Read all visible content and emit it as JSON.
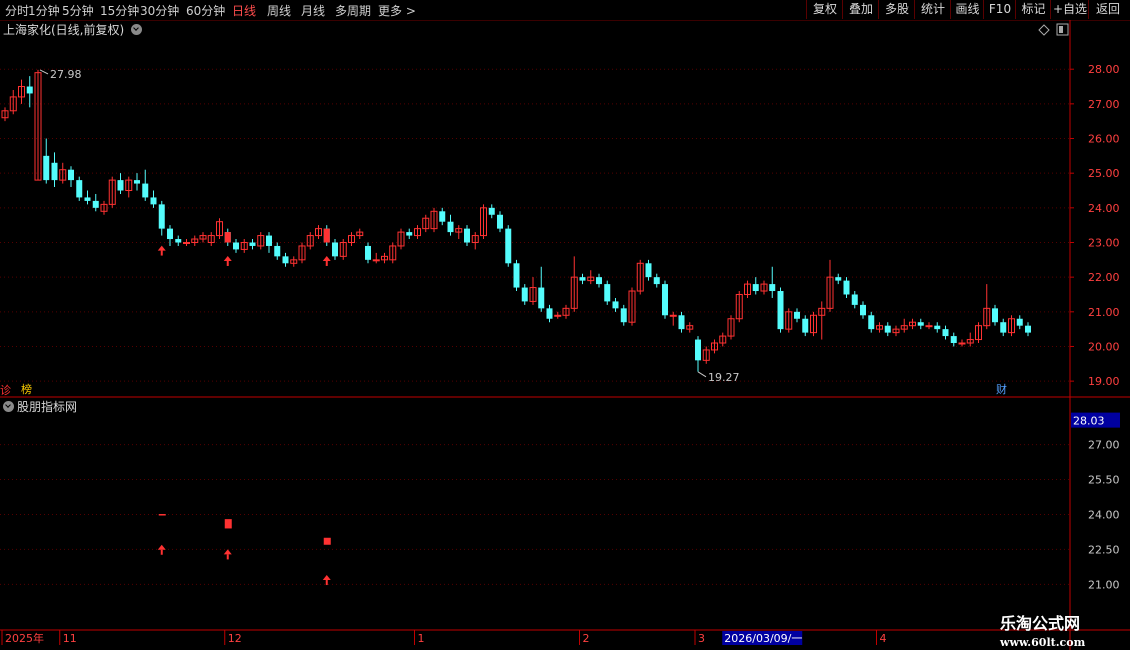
{
  "toolbar": {
    "periods": [
      "分时",
      "1分钟",
      "5分钟",
      "15分钟",
      "30分钟",
      "60分钟",
      "日线",
      "周线",
      "月线",
      "多周期",
      "更多 >"
    ],
    "active_period": "日线",
    "tools": [
      "复权",
      "叠加",
      "多股",
      "统计",
      "画线",
      "F10",
      "标记",
      "+自选",
      "返回"
    ]
  },
  "stock": {
    "title": "上海家化(日线,前复权)"
  },
  "markers": {
    "left_cut": "诊",
    "bang": "榜",
    "cai": "财"
  },
  "indicator": {
    "title": "股朋指标网",
    "current_value": "28.03"
  },
  "watermark": {
    "line1": "乐淘公式网",
    "line2": "www.60lt.com"
  },
  "colors": {
    "up": "#ff3232",
    "down": "#54fcfc",
    "grid": "#550000",
    "axis": "#c00000",
    "highlight": "#0000a0"
  },
  "chart_data": [
    {
      "type": "candlestick",
      "title": "上海家化(日线,前复权)",
      "ylim": [
        18.6,
        28.9
      ],
      "yticks": [
        19.0,
        20.0,
        21.0,
        22.0,
        23.0,
        24.0,
        25.0,
        26.0,
        27.0,
        28.0
      ],
      "ytick_labels": [
        "19.00",
        "20.00",
        "21.00",
        "22.00",
        "23.00",
        "24.00",
        "25.00",
        "26.00",
        "27.00",
        "28.00"
      ],
      "annotations": {
        "max_label": "27.98",
        "min_label": "19.27"
      },
      "signal_arrows": [
        19,
        27,
        39
      ],
      "candles": [
        [
          26.6,
          26.8,
          26.5,
          26.9
        ],
        [
          26.8,
          27.2,
          26.7,
          27.4
        ],
        [
          27.2,
          27.5,
          27.0,
          27.7
        ],
        [
          27.5,
          27.3,
          26.9,
          27.8
        ],
        [
          24.8,
          27.9,
          24.8,
          27.98
        ],
        [
          25.5,
          24.8,
          24.7,
          26.0
        ],
        [
          25.3,
          24.8,
          24.6,
          25.6
        ],
        [
          24.8,
          25.1,
          24.7,
          25.3
        ],
        [
          25.1,
          24.8,
          24.6,
          25.2
        ],
        [
          24.8,
          24.3,
          24.2,
          24.9
        ],
        [
          24.3,
          24.2,
          24.1,
          24.5
        ],
        [
          24.2,
          24.0,
          23.9,
          24.4
        ],
        [
          23.9,
          24.1,
          23.8,
          24.2
        ],
        [
          24.1,
          24.8,
          24.0,
          24.9
        ],
        [
          24.8,
          24.5,
          24.4,
          25.0
        ],
        [
          24.5,
          24.8,
          24.3,
          24.9
        ],
        [
          24.8,
          24.7,
          24.5,
          25.0
        ],
        [
          24.7,
          24.3,
          24.2,
          25.1
        ],
        [
          24.3,
          24.1,
          24.0,
          24.5
        ],
        [
          24.1,
          23.4,
          23.2,
          24.2
        ],
        [
          23.4,
          23.1,
          22.9,
          23.5
        ],
        [
          23.1,
          23.0,
          22.9,
          23.2
        ],
        [
          23.0,
          23.0,
          22.9,
          23.1
        ],
        [
          23.0,
          23.1,
          22.9,
          23.2
        ],
        [
          23.1,
          23.2,
          23.0,
          23.3
        ],
        [
          23.0,
          23.2,
          22.9,
          23.3
        ],
        [
          23.2,
          23.6,
          23.1,
          23.7
        ],
        [
          23.3,
          23.0,
          22.9,
          23.4
        ],
        [
          23.0,
          22.8,
          22.7,
          23.1
        ],
        [
          22.8,
          23.0,
          22.7,
          23.1
        ],
        [
          23.0,
          22.9,
          22.8,
          23.1
        ],
        [
          22.9,
          23.2,
          22.8,
          23.3
        ],
        [
          23.2,
          22.9,
          22.7,
          23.3
        ],
        [
          22.9,
          22.6,
          22.5,
          23.0
        ],
        [
          22.6,
          22.4,
          22.3,
          22.7
        ],
        [
          22.4,
          22.5,
          22.3,
          22.6
        ],
        [
          22.5,
          22.9,
          22.4,
          23.0
        ],
        [
          22.9,
          23.2,
          22.8,
          23.3
        ],
        [
          23.2,
          23.4,
          23.1,
          23.5
        ],
        [
          23.4,
          23.0,
          22.9,
          23.5
        ],
        [
          23.0,
          22.6,
          22.5,
          23.1
        ],
        [
          22.6,
          23.0,
          22.5,
          23.1
        ],
        [
          23.0,
          23.2,
          22.9,
          23.3
        ],
        [
          23.2,
          23.3,
          23.1,
          23.4
        ],
        [
          22.9,
          22.5,
          22.4,
          23.0
        ],
        [
          22.5,
          22.5,
          22.4,
          22.7
        ],
        [
          22.5,
          22.6,
          22.4,
          22.7
        ],
        [
          22.5,
          22.9,
          22.4,
          23.0
        ],
        [
          22.9,
          23.3,
          22.8,
          23.4
        ],
        [
          23.3,
          23.2,
          23.1,
          23.4
        ],
        [
          23.2,
          23.4,
          23.1,
          23.5
        ],
        [
          23.4,
          23.7,
          23.3,
          23.8
        ],
        [
          23.4,
          23.9,
          23.3,
          24.0
        ],
        [
          23.9,
          23.6,
          23.5,
          24.0
        ],
        [
          23.6,
          23.3,
          23.2,
          23.8
        ],
        [
          23.3,
          23.4,
          23.1,
          23.5
        ],
        [
          23.4,
          23.0,
          22.9,
          23.5
        ],
        [
          23.0,
          23.2,
          22.8,
          23.3
        ],
        [
          23.2,
          24.0,
          23.1,
          24.1
        ],
        [
          24.0,
          23.8,
          23.7,
          24.1
        ],
        [
          23.8,
          23.4,
          23.3,
          23.9
        ],
        [
          23.4,
          22.4,
          22.3,
          23.5
        ],
        [
          22.4,
          21.7,
          21.6,
          22.5
        ],
        [
          21.7,
          21.3,
          21.2,
          21.8
        ],
        [
          21.3,
          21.7,
          21.2,
          22.0
        ],
        [
          21.7,
          21.1,
          21.0,
          22.3
        ],
        [
          21.1,
          20.8,
          20.7,
          21.2
        ],
        [
          20.9,
          20.9,
          20.8,
          21.0
        ],
        [
          20.9,
          21.1,
          20.8,
          21.2
        ],
        [
          21.1,
          22.0,
          21.0,
          22.6
        ],
        [
          22.0,
          21.9,
          21.8,
          22.1
        ],
        [
          21.9,
          22.0,
          21.8,
          22.2
        ],
        [
          22.0,
          21.8,
          21.7,
          22.1
        ],
        [
          21.8,
          21.3,
          21.2,
          21.9
        ],
        [
          21.3,
          21.1,
          21.0,
          21.4
        ],
        [
          21.1,
          20.7,
          20.6,
          21.2
        ],
        [
          20.7,
          21.6,
          20.6,
          21.7
        ],
        [
          21.6,
          22.4,
          21.5,
          22.5
        ],
        [
          22.4,
          22.0,
          21.9,
          22.5
        ],
        [
          22.0,
          21.8,
          21.7,
          22.1
        ],
        [
          21.8,
          20.9,
          20.8,
          21.9
        ],
        [
          20.9,
          20.9,
          20.6,
          21.0
        ],
        [
          20.9,
          20.5,
          20.4,
          21.0
        ],
        [
          20.5,
          20.6,
          20.4,
          20.7
        ],
        [
          20.2,
          19.6,
          19.27,
          20.3
        ],
        [
          19.6,
          19.9,
          19.5,
          20.0
        ],
        [
          19.9,
          20.1,
          19.8,
          20.2
        ],
        [
          20.1,
          20.3,
          20.0,
          20.4
        ],
        [
          20.3,
          20.8,
          20.2,
          20.9
        ],
        [
          20.8,
          21.5,
          20.7,
          21.6
        ],
        [
          21.5,
          21.8,
          21.4,
          21.9
        ],
        [
          21.8,
          21.6,
          21.5,
          22.0
        ],
        [
          21.6,
          21.8,
          21.5,
          21.9
        ],
        [
          21.8,
          21.6,
          21.4,
          22.3
        ],
        [
          21.6,
          20.5,
          20.4,
          21.7
        ],
        [
          20.5,
          21.0,
          20.4,
          21.1
        ],
        [
          21.0,
          20.8,
          20.7,
          21.1
        ],
        [
          20.8,
          20.4,
          20.3,
          20.9
        ],
        [
          20.4,
          20.9,
          20.3,
          21.0
        ],
        [
          20.9,
          21.1,
          20.2,
          21.3
        ],
        [
          21.1,
          22.0,
          21.0,
          22.5
        ],
        [
          22.0,
          21.9,
          21.8,
          22.1
        ],
        [
          21.9,
          21.5,
          21.4,
          22.0
        ],
        [
          21.5,
          21.2,
          21.1,
          21.6
        ],
        [
          21.2,
          20.9,
          20.8,
          21.3
        ],
        [
          20.9,
          20.5,
          20.4,
          21.0
        ],
        [
          20.5,
          20.6,
          20.4,
          20.7
        ],
        [
          20.6,
          20.4,
          20.3,
          20.7
        ],
        [
          20.4,
          20.5,
          20.3,
          20.6
        ],
        [
          20.5,
          20.6,
          20.4,
          20.8
        ],
        [
          20.6,
          20.7,
          20.5,
          20.8
        ],
        [
          20.7,
          20.6,
          20.5,
          20.8
        ],
        [
          20.6,
          20.6,
          20.5,
          20.7
        ],
        [
          20.6,
          20.5,
          20.4,
          20.7
        ],
        [
          20.5,
          20.3,
          20.2,
          20.6
        ],
        [
          20.3,
          20.1,
          20.0,
          20.4
        ],
        [
          20.1,
          20.1,
          20.0,
          20.2
        ],
        [
          20.1,
          20.2,
          20.0,
          20.4
        ],
        [
          20.2,
          20.6,
          20.1,
          20.7
        ],
        [
          20.6,
          21.1,
          20.5,
          21.8
        ],
        [
          21.1,
          20.7,
          20.6,
          21.2
        ],
        [
          20.7,
          20.4,
          20.3,
          20.8
        ],
        [
          20.4,
          20.8,
          20.3,
          20.9
        ],
        [
          20.8,
          20.6,
          20.5,
          20.9
        ],
        [
          20.6,
          20.4,
          20.3,
          20.7
        ]
      ]
    },
    {
      "type": "indicator",
      "title": "股朋指标网",
      "ylim": [
        20.5,
        28.4
      ],
      "yticks": [
        21.0,
        22.5,
        24.0,
        25.5,
        27.0
      ],
      "ytick_labels": [
        "21.00",
        "22.50",
        "24.00",
        "25.50",
        "27.00"
      ],
      "current_value": 28.03,
      "blocks": [
        {
          "index": 19,
          "low": 23.98,
          "high": 24.02
        },
        {
          "index": 27,
          "low": 23.4,
          "high": 23.8
        },
        {
          "index": 39,
          "low": 22.7,
          "high": 23.0
        }
      ],
      "arrows": [
        {
          "index": 19,
          "value": 22.7
        },
        {
          "index": 27,
          "value": 22.5
        },
        {
          "index": 39,
          "value": 21.4
        }
      ]
    }
  ],
  "xaxis": {
    "labels": [
      {
        "text": "2025年",
        "index": 0
      },
      {
        "text": "11",
        "index": 7
      },
      {
        "text": "12",
        "index": 27
      },
      {
        "text": "1",
        "index": 50
      },
      {
        "text": "2",
        "index": 70
      },
      {
        "text": "3",
        "index": 84
      },
      {
        "text": "4",
        "index": 106
      }
    ],
    "highlight": {
      "text": "2026/03/09/一",
      "index": 89
    }
  }
}
